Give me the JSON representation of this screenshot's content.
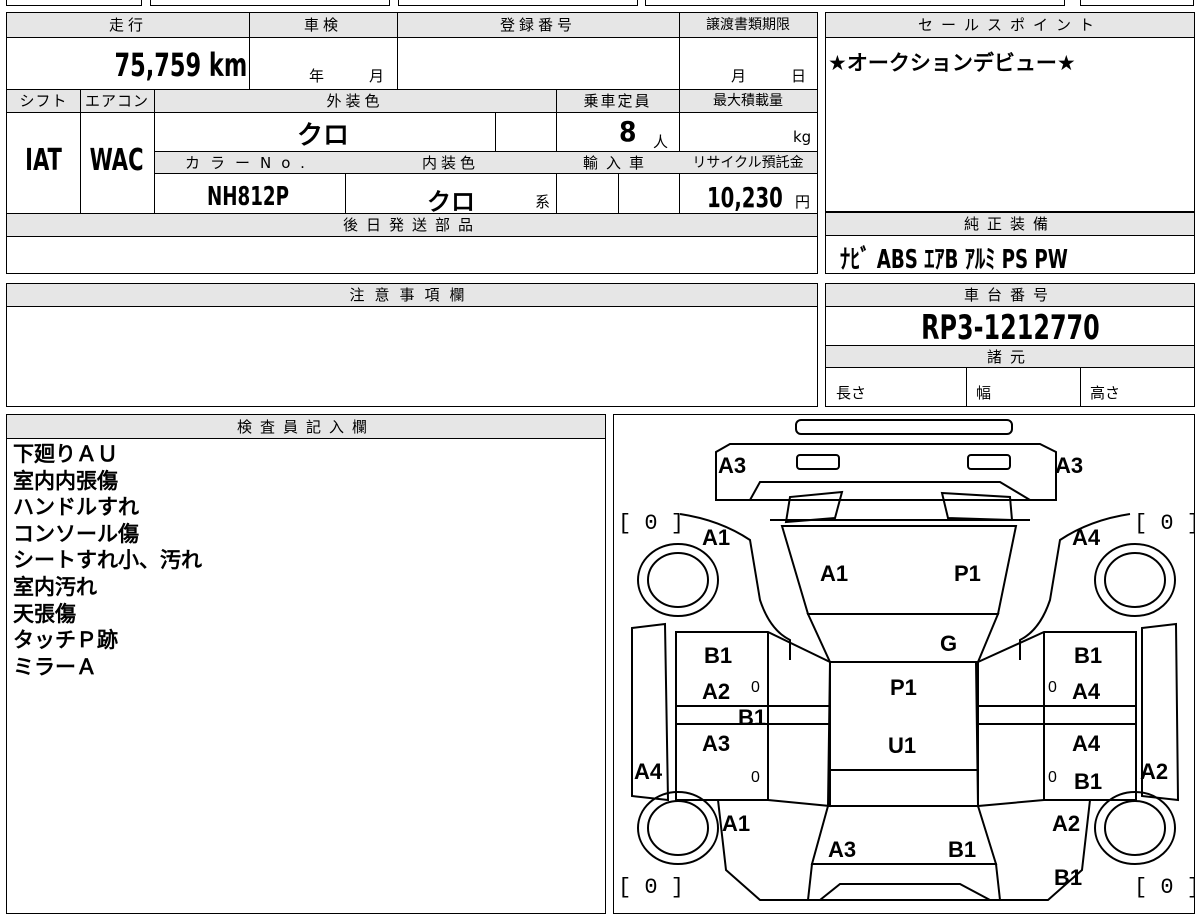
{
  "top": {
    "mileage_label": "走行",
    "mileage_value": "75,759 km",
    "inspection_label": "車検",
    "inspection_year": "年",
    "inspection_month": "月",
    "registration_label": "登録番号",
    "transfer_deadline_label": "譲渡書類期限",
    "transfer_month": "月",
    "transfer_day": "日",
    "shift_label": "シフト",
    "shift_value": "IAT",
    "aircon_label": "エアコン",
    "aircon_value": "WAC",
    "exterior_color_label": "外装色",
    "exterior_color_value": "クロ",
    "capacity_label": "乗車定員",
    "capacity_value": "8",
    "capacity_unit": "人",
    "max_load_label": "最大積載量",
    "max_load_unit": "kg",
    "color_no_label": "カラーNo.",
    "color_no_value": "NH812P",
    "interior_color_label": "内装色",
    "interior_color_value": "クロ",
    "interior_color_suffix": "系",
    "import_label": "輸入車",
    "recycle_label": "リサイクル預託金",
    "recycle_value": "10,230",
    "recycle_unit": "円",
    "later_parts_label": "後日発送部品"
  },
  "sales_point": {
    "label": "セールスポイント",
    "text": "★オークションデビュー★"
  },
  "genuine_equipment": {
    "label": "純正装備",
    "text": "ﾅﾋﾞ  ABS  ｴｱB  ｱﾙﾐ  PS  PW"
  },
  "notes": {
    "label": "注意事項欄"
  },
  "chassis": {
    "label": "車台番号",
    "value": "RP3-1212770",
    "specs_label": "諸元",
    "length_label": "長さ",
    "width_label": "幅",
    "height_label": "高さ"
  },
  "inspector": {
    "label": "検査員記入欄",
    "lines": [
      "下廻りＡＵ",
      "室内内張傷",
      "ハンドルすれ",
      "コンソール傷",
      "シートすれ小、汚れ",
      "室内汚れ",
      "天張傷",
      "タッチＰ跡",
      "ミラーＡ"
    ]
  },
  "diagram": {
    "labels": {
      "front_left": "A3",
      "front_right": "A3",
      "fl_wheel_bracket": "[ 0 ]",
      "fr_wheel_bracket": "[ 0 ]",
      "rl_wheel_bracket": "[ 0 ]",
      "rr_wheel_bracket": "[ 0 ]",
      "fl_fender": "A1",
      "fr_fender": "A4",
      "hood_left": "A1",
      "hood_right": "P1",
      "windshield": "G",
      "roof_top": "P1",
      "roof_bottom": "U1",
      "fl_door_top": "B1",
      "fl_door_mid": "A2",
      "fl_door_mark": "0",
      "center_left": "B1",
      "rl_door": "A3",
      "rl_door_mark": "0",
      "fr_door_top": "B1",
      "fr_door_mark": "0",
      "fr_door_mid": "A4",
      "rr_door": "A4",
      "rr_door_mark": "0",
      "rr_door_bottom": "B1",
      "left_sill": "A4",
      "right_sill": "A2",
      "rl_fender": "A1",
      "rr_fender": "A2",
      "rear_left": "A3",
      "rear_right": "B1",
      "rear_corner_right": "B1"
    }
  }
}
